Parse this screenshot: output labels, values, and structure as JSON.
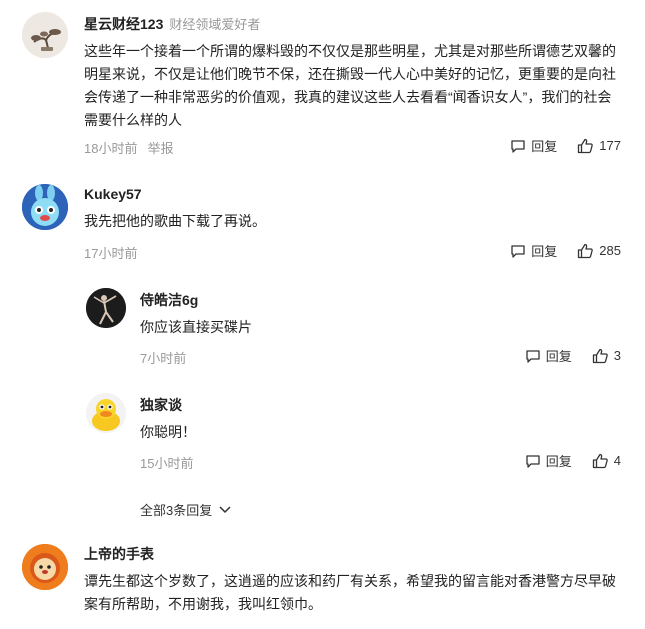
{
  "comments": [
    {
      "user": "星云财经123",
      "tag": "财经领域爱好者",
      "text": "这些年一个接着一个所谓的爆料毁的不仅仅是那些明星，尤其是对那些所谓德艺双馨的明星来说，不仅是让他们晚节不保，还在撕毁一代人心中美好的记忆，更重要的是向社会传递了一种非常恶劣的价值观，我真的建议这些人去看看“闻香识女人”，我们的社会需要什么样的人",
      "time": "18小时前",
      "report": "举报",
      "reply_label": "回复",
      "likes": "177",
      "avatar_icon": "bonsai-avatar"
    },
    {
      "user": "Kukey57",
      "text": "我先把他的歌曲下载了再说。",
      "time": "17小时前",
      "reply_label": "回复",
      "likes": "285",
      "avatar_icon": "blue-bunny-avatar",
      "replies": [
        {
          "user": "侍皓洁6g",
          "text": "你应该直接买碟片",
          "time": "7小时前",
          "reply_label": "回复",
          "likes": "3",
          "avatar_icon": "dancer-avatar"
        },
        {
          "user": "独家谈",
          "text": "你聪明！",
          "time": "15小时前",
          "reply_label": "回复",
          "likes": "4",
          "avatar_icon": "yellow-duck-avatar"
        }
      ],
      "more_replies": "全部3条回复"
    },
    {
      "user": "上帝的手表",
      "text": "谭先生都这个岁数了，这逍遥的应该和药厂有关系，希望我的留言能对香港警方尽早破案有所帮助，不用谢我，我叫红领巾。",
      "time": "",
      "reply_label": "",
      "likes": "",
      "avatar_icon": "cartoon-lion-avatar"
    }
  ],
  "colors": {
    "text": "#222222",
    "muted": "#999999",
    "action": "#333333"
  }
}
